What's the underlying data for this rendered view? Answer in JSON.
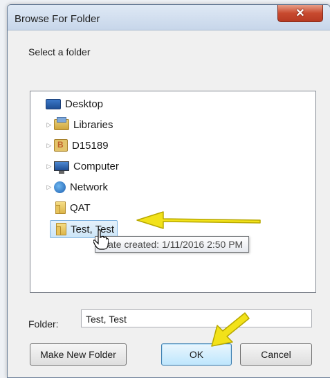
{
  "window": {
    "title": "Browse For Folder",
    "close_label": "✕"
  },
  "prompt": "Select a folder",
  "tree": {
    "items": [
      {
        "label": "Desktop",
        "icon": "desktop-icon",
        "expander": ""
      },
      {
        "label": "Libraries",
        "icon": "libraries-icon",
        "expander": "▷"
      },
      {
        "label": "D15189",
        "icon": "user-folder-icon",
        "expander": "▷"
      },
      {
        "label": "Computer",
        "icon": "computer-icon",
        "expander": "▷"
      },
      {
        "label": "Network",
        "icon": "network-icon",
        "expander": "▷"
      },
      {
        "label": "QAT",
        "icon": "folder-icon",
        "expander": ""
      },
      {
        "label": "Test, Test",
        "icon": "folder-icon",
        "expander": "",
        "selected": true
      }
    ],
    "tooltip": "Date created: 1/11/2016 2:50 PM"
  },
  "folder": {
    "label": "Folder:",
    "value": "Test, Test"
  },
  "buttons": {
    "new_folder": "Make New Folder",
    "ok": "OK",
    "cancel": "Cancel"
  },
  "colors": {
    "annotation_arrow": "#f2e21a",
    "selection": "#cde6f8",
    "close_button": "#c84a2f"
  }
}
